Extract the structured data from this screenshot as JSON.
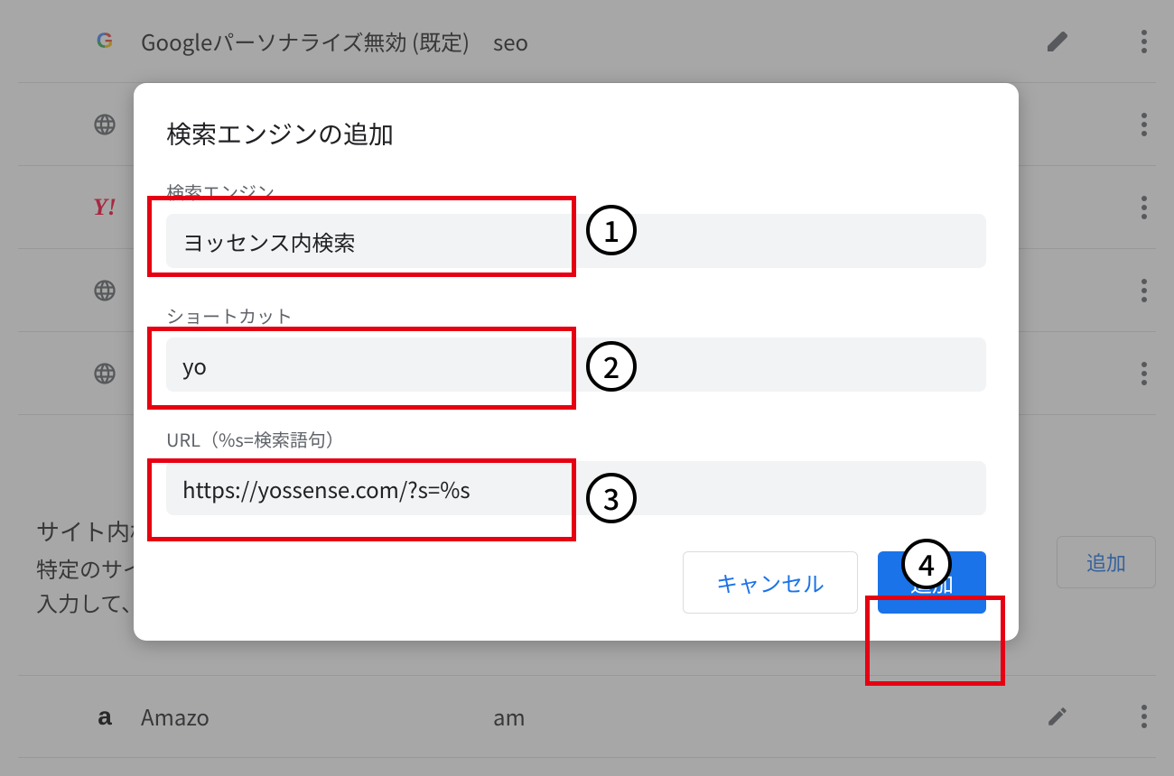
{
  "background": {
    "rows": [
      {
        "icon": "google",
        "name": "Googleパーソナライズ無効 (既定)",
        "shortcut": "seo",
        "edit": true
      },
      {
        "icon": "globe",
        "name": "",
        "shortcut": "",
        "edit": false
      },
      {
        "icon": "yahoo",
        "name": "",
        "shortcut": "",
        "edit": false
      },
      {
        "icon": "globe",
        "name": "",
        "shortcut": "",
        "edit": false
      },
      {
        "icon": "globe",
        "name": "",
        "shortcut": "",
        "edit": false
      }
    ],
    "section_title": "サイト内検",
    "section_desc_line1": "特定のサイ",
    "section_desc_line2": "入力して、",
    "add_button": "追加",
    "bottom_row": {
      "icon": "amazon",
      "name": "Amazo",
      "shortcut": "am",
      "edit": true
    }
  },
  "dialog": {
    "title": "検索エンジンの追加",
    "label_engine": "検索エンジン",
    "value_engine": "ヨッセンス内検索",
    "label_shortcut": "ショートカット",
    "value_shortcut": "yo",
    "label_url": "URL（%s=検索語句）",
    "value_url": "https://yossense.com/?s=%s",
    "cancel": "キャンセル",
    "add": "追加"
  },
  "annotations": {
    "m1": "1",
    "m2": "2",
    "m3": "3",
    "m4": "4"
  }
}
